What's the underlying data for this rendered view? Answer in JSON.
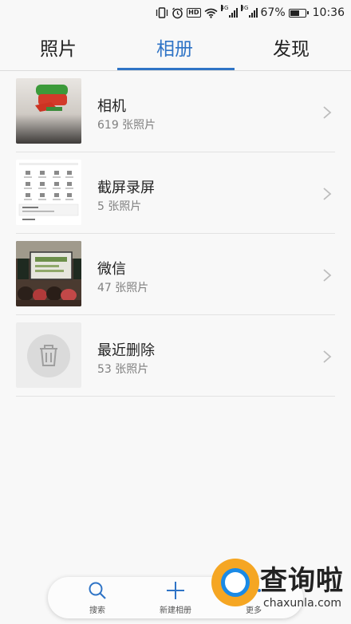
{
  "status_bar": {
    "network_left": "4G",
    "network_right": "3G",
    "battery_percent": "67%",
    "battery_level": 0.67,
    "time": "10:36",
    "hd": "HD",
    "icons": [
      "vibrate-icon",
      "alarm-icon",
      "hd-icon",
      "wifi-icon",
      "signal-icon",
      "signal-icon",
      "battery-icon"
    ]
  },
  "tabs": [
    {
      "label": "照片",
      "active": false
    },
    {
      "label": "相册",
      "active": true
    },
    {
      "label": "发现",
      "active": false
    }
  ],
  "accent_color": "#2f74c6",
  "albums": [
    {
      "name": "相机",
      "count": "619 张照片"
    },
    {
      "name": "截屏录屏",
      "count": "5 张照片"
    },
    {
      "name": "微信",
      "count": "47 张照片"
    },
    {
      "name": "最近删除",
      "count": "53 张照片"
    }
  ],
  "bottom_bar": {
    "items": [
      {
        "label": "搜索",
        "icon": "search-icon"
      },
      {
        "label": "新建相册",
        "icon": "plus-icon"
      },
      {
        "label": "更多",
        "icon": "more-icon"
      }
    ]
  },
  "watermark": {
    "title": "查询啦",
    "url": "chaxunla.com"
  }
}
